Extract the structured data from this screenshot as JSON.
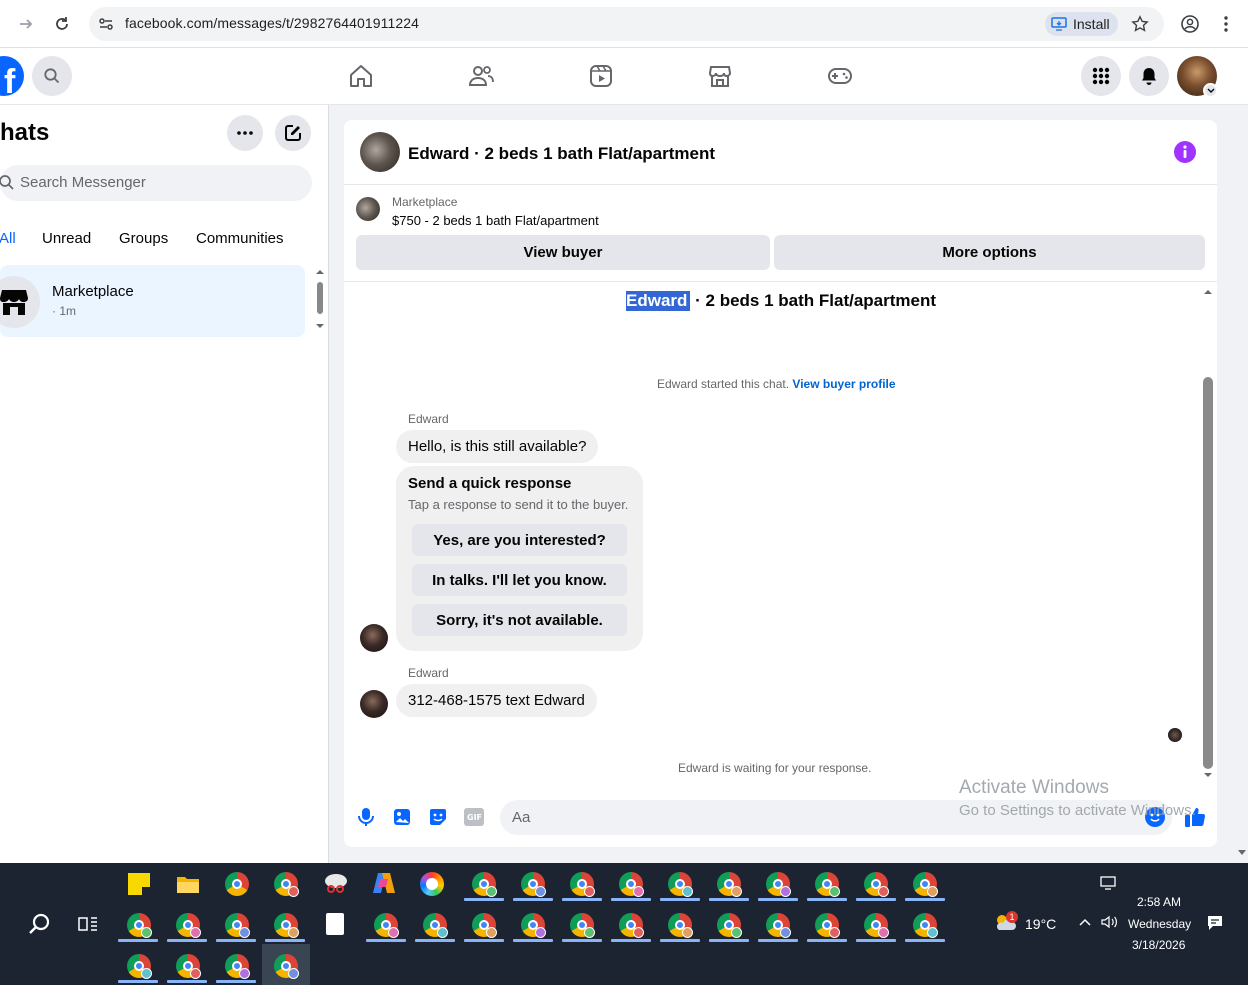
{
  "browser": {
    "url": "facebook.com/messages/t/2982764401911224",
    "install_label": "Install"
  },
  "sidebar": {
    "title": "hats",
    "search_placeholder": "Search Messenger",
    "filters": [
      "All",
      "Unread",
      "Groups",
      "Communities"
    ],
    "conversations": [
      {
        "name": "Marketplace",
        "meta": "· 1m"
      }
    ]
  },
  "chat": {
    "header_title": "Edward · 2 beds 1 bath Flat/apartment",
    "listing": {
      "source": "Marketplace",
      "title": "$750 - 2 beds 1 bath Flat/apartment"
    },
    "buttons": {
      "view_buyer": "View buyer",
      "more_options": "More options"
    },
    "thread_title_name": "Edward",
    "thread_title_rest": " · 2 beds 1 bath Flat/apartment",
    "started_text": "Edward started this chat.",
    "started_link": "View buyer profile",
    "messages": [
      {
        "sender": "Edward",
        "text": "Hello, is this still available?"
      },
      {
        "sender": "Edward",
        "text": "312-468-1575 text Edward"
      }
    ],
    "quick_response": {
      "title": "Send a quick response",
      "subtitle": "Tap a response to send it to the buyer.",
      "options": [
        "Yes, are you interested?",
        "In talks. I'll let you know.",
        "Sorry, it's not available."
      ]
    },
    "waiting_text": "Edward is waiting for your response.",
    "composer_placeholder": "Aa"
  },
  "watermark": {
    "line1": "Activate Windows",
    "line2": "Go to Settings to activate Windows."
  },
  "taskbar": {
    "temperature": "19°C",
    "weather_badge": "1",
    "time": "2:58 AM",
    "day": "Wednesday",
    "date": "3/18/2026"
  },
  "colors": {
    "facebook_blue": "#0866ff",
    "info_purple": "#a033ff",
    "selection_blue": "#3367d6"
  },
  "icons": {
    "nav": [
      "home-icon",
      "friends-icon",
      "video-icon",
      "marketplace-icon",
      "gaming-icon"
    ]
  }
}
